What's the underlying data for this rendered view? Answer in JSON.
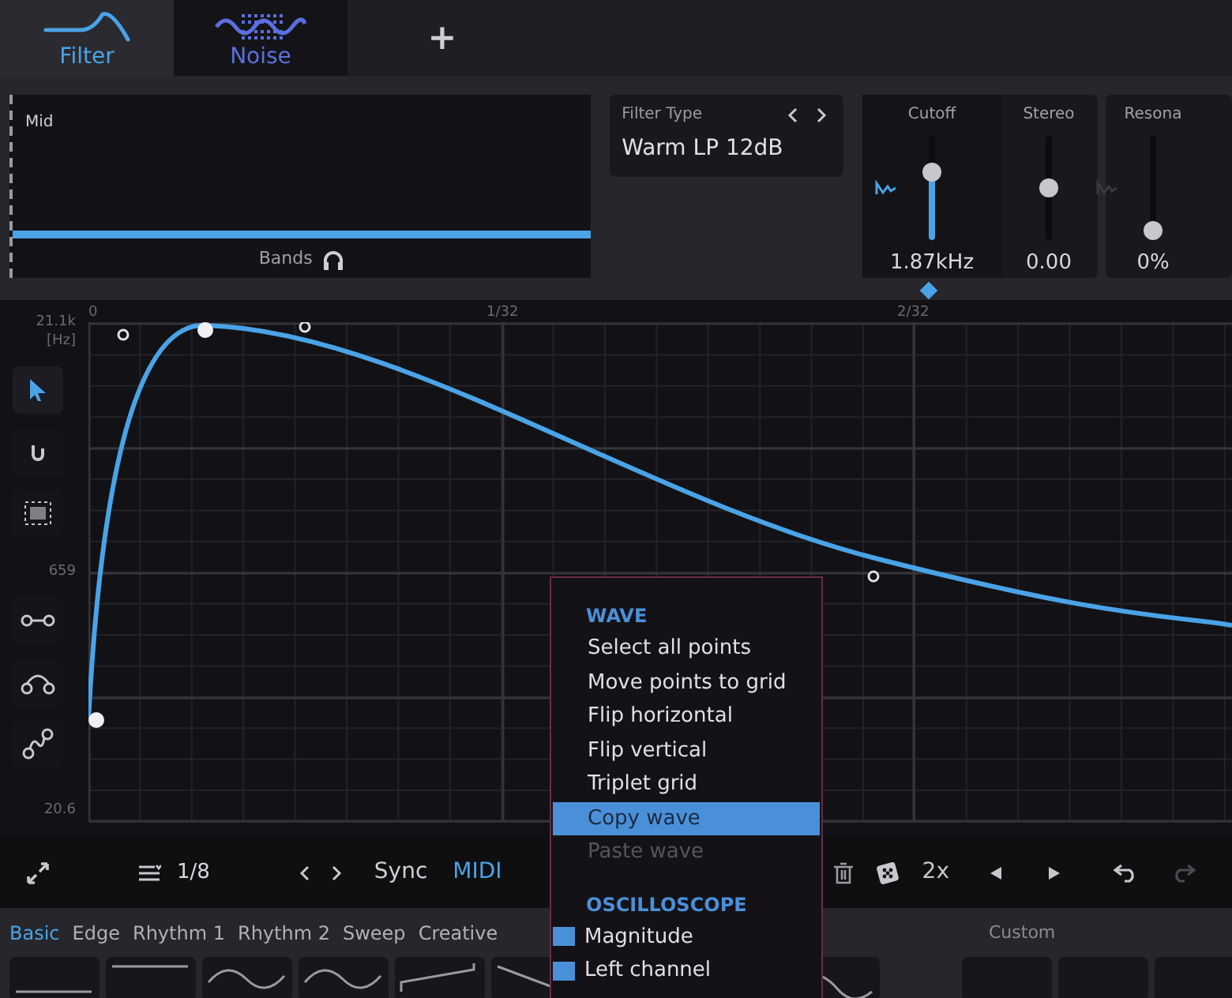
{
  "tabs": [
    {
      "label": "Filter",
      "kind": "filter",
      "selected": true
    },
    {
      "label": "Noise",
      "kind": "noise",
      "selected": false
    }
  ],
  "add_tab": "+",
  "bands": {
    "label": "Mid",
    "footer": "Bands",
    "level": 1
  },
  "filter_type": {
    "label": "Filter Type",
    "value": "Warm LP 12dB"
  },
  "sliders": [
    {
      "label": "Cutoff",
      "value": "1.87kHz",
      "kind": "unipolar",
      "level": 0.66,
      "modulated": true
    },
    {
      "label": "Stereo",
      "value": "0.00",
      "kind": "bipolar",
      "level": 0.5
    },
    {
      "label": "Resona",
      "value": "0%",
      "kind": "unipolar",
      "level": 0.09,
      "modulated": false
    }
  ],
  "graph": {
    "x_labels": [
      "0",
      "1/32",
      "2/32"
    ],
    "y_labels": [
      "21.1k",
      "[Hz]",
      "659",
      "20.6"
    ],
    "tools": [
      {
        "kind": "pointer",
        "selected": true
      },
      {
        "kind": "magnet",
        "selected": false
      },
      {
        "kind": "select-area",
        "selected": false
      },
      {
        "kind": "linear",
        "selected": false
      },
      {
        "kind": "curve",
        "selected": false
      },
      {
        "kind": "s-curve",
        "selected": false
      }
    ]
  },
  "toolbar": {
    "grid": "1/8",
    "toggles": [
      {
        "label": "Sync",
        "on": false
      },
      {
        "label": "MIDI",
        "on": true
      }
    ],
    "multiply": "2x"
  },
  "presets": {
    "tabs": [
      {
        "label": "Basic",
        "selected": true
      },
      {
        "label": "Edge",
        "selected": false
      },
      {
        "label": "Rhythm 1",
        "selected": false
      },
      {
        "label": "Rhythm 2",
        "selected": false
      },
      {
        "label": "Sweep",
        "selected": false
      },
      {
        "label": "Creative",
        "selected": false
      }
    ],
    "custom": "Custom",
    "tiles": [
      {
        "kind": "low"
      },
      {
        "kind": "high"
      },
      {
        "kind": "sine"
      },
      {
        "kind": "sine"
      },
      {
        "kind": "saw"
      },
      {
        "kind": "ramp"
      }
    ],
    "tiles_after_menu": [
      {
        "kind": "decay"
      }
    ]
  },
  "menu": {
    "sections": [
      {
        "title": "WAVE",
        "items": [
          {
            "kind": "action",
            "label": "Select all points",
            "highlighted": false,
            "disabled": false
          },
          {
            "kind": "action",
            "label": "Move points to grid",
            "highlighted": false,
            "disabled": false
          },
          {
            "kind": "action",
            "label": "Flip horizontal",
            "highlighted": false,
            "disabled": false
          },
          {
            "kind": "action",
            "label": "Flip vertical",
            "highlighted": false,
            "disabled": false
          },
          {
            "kind": "action",
            "label": "Triplet grid",
            "highlighted": false,
            "disabled": false
          },
          {
            "kind": "action",
            "label": "Copy wave",
            "highlighted": true,
            "disabled": false
          },
          {
            "kind": "action",
            "label": "Paste wave",
            "highlighted": false,
            "disabled": true
          }
        ]
      },
      {
        "title": "OSCILLOSCOPE",
        "items": [
          {
            "kind": "check",
            "label": "Magnitude",
            "checked": true
          },
          {
            "kind": "check",
            "label": "Left channel",
            "checked": true
          }
        ]
      }
    ]
  }
}
